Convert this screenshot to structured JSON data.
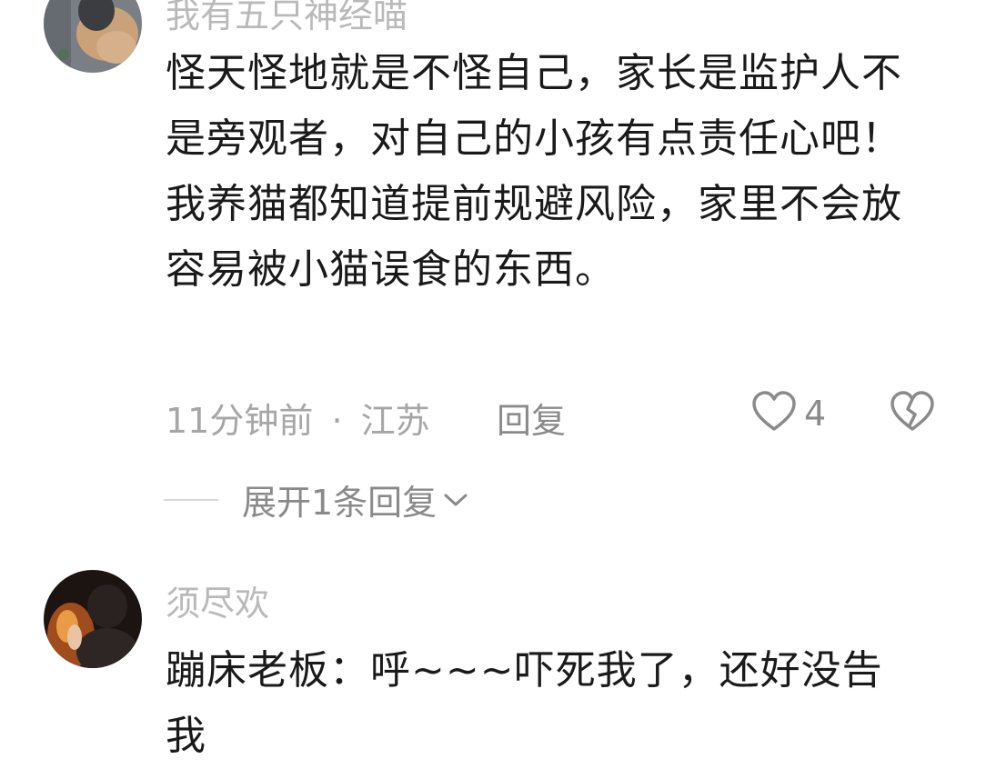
{
  "comments": [
    {
      "username": "我有五只神经喵",
      "text": "怪天怪地就是不怪自己，家长是监护人不是旁观者，对自己的小孩有点责任心吧！我养猫都知道提前规避风险，家里不会放容易被小猫误食的东西。",
      "time": "11分钟前",
      "location": "江苏",
      "separator": "·",
      "reply_label": "回复",
      "like_count": "4",
      "expand_replies": "展开1条回复"
    },
    {
      "username": "须尽欢",
      "text": "蹦床老板：呼~~~吓死我了，还好没告我"
    }
  ],
  "icons": {
    "like": "heart-outline-icon",
    "dislike": "broken-heart-icon",
    "expand": "chevron-down-icon"
  },
  "colors": {
    "username": "#b9b9b9",
    "text": "#1a1a1a",
    "meta": "#a6a6a6",
    "action": "#8a8a8a"
  }
}
